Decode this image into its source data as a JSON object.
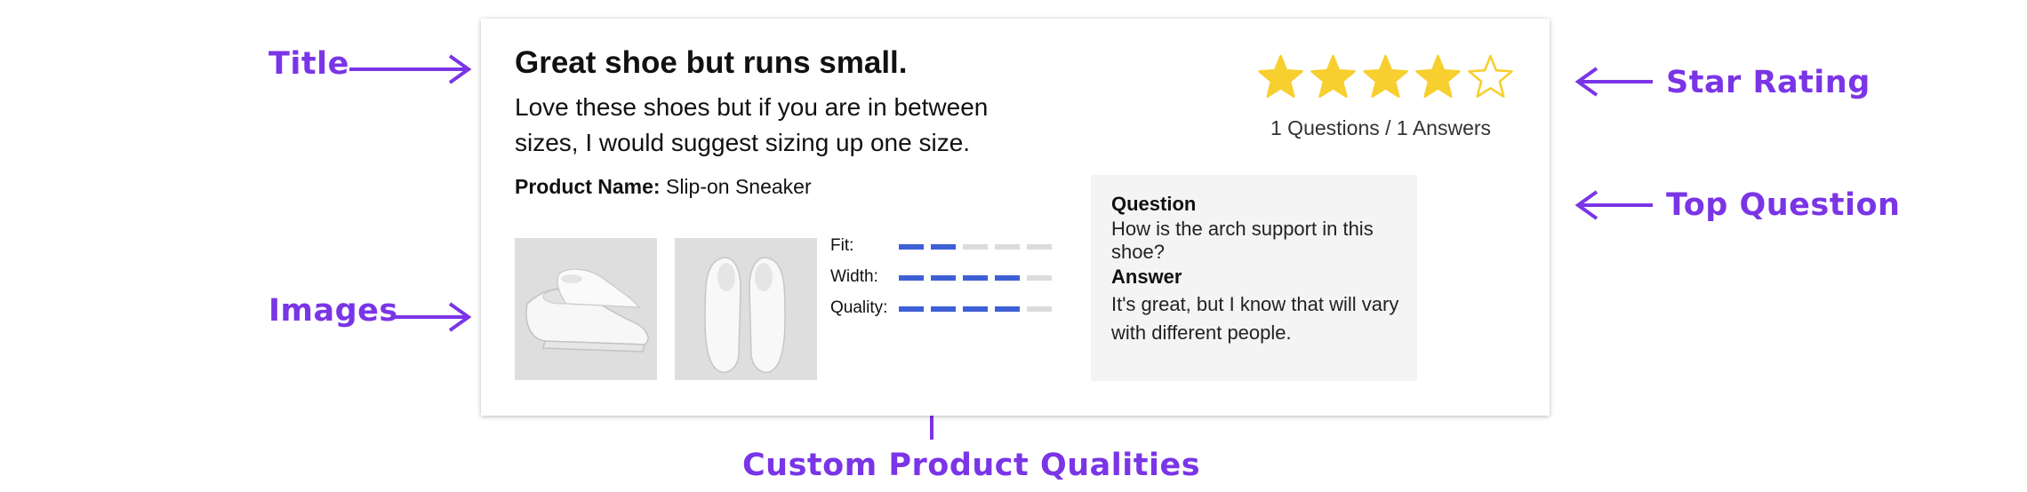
{
  "callouts": {
    "title": "Title",
    "images": "Images",
    "star_rating": "Star Rating",
    "top_question": "Top Question",
    "custom_qualities": "Custom Product Qualities"
  },
  "colors": {
    "callout": "#7a35e6",
    "star": "#f7cf2e",
    "bar_filled": "#3f5fd6",
    "bar_empty": "#dcdcdc"
  },
  "review": {
    "title": "Great shoe but runs small.",
    "body": "Love these shoes but if you are in between sizes, I would suggest sizing up one size.",
    "product_label": "Product Name:",
    "product_name": "Slip-on Sneaker",
    "images": [
      "shoe-side-view",
      "shoe-top-view"
    ],
    "qualities": [
      {
        "label": "Fit:",
        "filled": 2,
        "total": 5
      },
      {
        "label": "Width:",
        "filled": 4,
        "total": 5
      },
      {
        "label": "Quality:",
        "filled": 4,
        "total": 5
      }
    ],
    "rating": {
      "value": 4,
      "max": 5
    },
    "qa_count": "1 Questions / 1 Answers",
    "top_question": {
      "question_label": "Question",
      "question": "How is the arch support in this shoe?",
      "answer_label": "Answer",
      "answer": "It's great, but I know that will vary with different people."
    }
  }
}
